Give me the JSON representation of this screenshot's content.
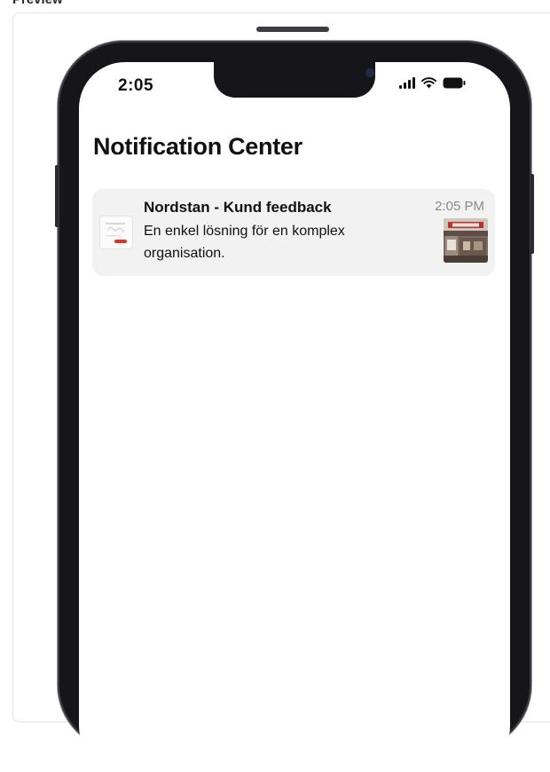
{
  "page": {
    "label": "Preview"
  },
  "status_bar": {
    "time": "2:05",
    "icons": [
      "signal-icon",
      "wifi-icon",
      "battery-icon"
    ]
  },
  "notification_center": {
    "title": "Notification Center",
    "notifications": [
      {
        "title": "Nordstan - Kund feedback",
        "time": "2:05 PM",
        "body": "En enkel lösning för en komplex organisation.",
        "app_icon": "app-logo-icon",
        "thumbnail": "attachment-thumbnail"
      }
    ]
  },
  "colors": {
    "phone_frame": "#16161a",
    "notification_bg": "#f2f2f2",
    "time_gray": "#8a8a8e",
    "accent_red": "#d7332c"
  }
}
